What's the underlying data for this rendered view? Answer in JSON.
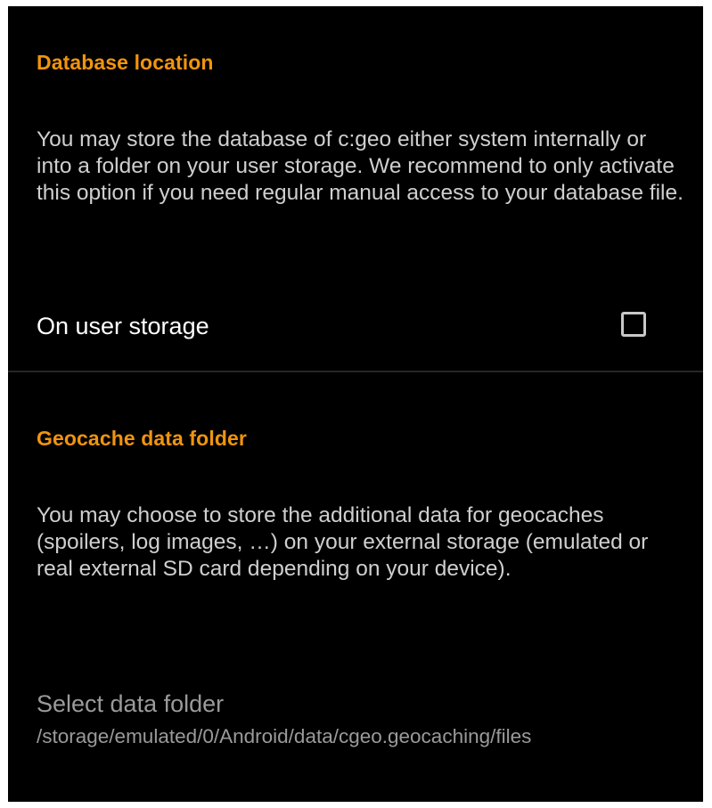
{
  "database_section": {
    "header": "Database location",
    "description": "You may store the database of c:geo either system internally or into a folder on your user storage. We recommend to only activate this option if you need regular manual access to your database file.",
    "user_storage": {
      "label": "On user storage",
      "checked": false
    }
  },
  "geocache_section": {
    "header": "Geocache data folder",
    "description": "You may choose to store the additional data for geocaches (spoilers, log images, …) on your external storage (emulated or real external SD card depending on your device).",
    "select_folder": {
      "label": "Select data folder",
      "path": "/storage/emulated/0/Android/data/cgeo.geocaching/files"
    }
  },
  "colors": {
    "background": "#000000",
    "accent": "#f0940f",
    "primary_text": "#ffffff",
    "secondary_text": "#cfcfcf",
    "disabled_text": "#9a9a9a"
  }
}
